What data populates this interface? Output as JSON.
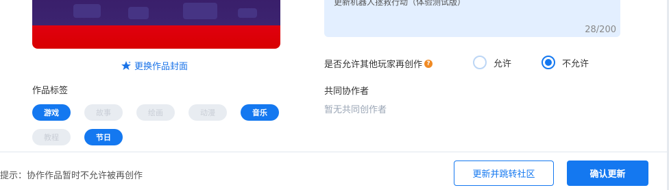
{
  "cover": {
    "change_label": "更换作品封面"
  },
  "tags": {
    "title": "作品标签",
    "items": [
      {
        "label": "游戏",
        "selected": true
      },
      {
        "label": "故事",
        "selected": false
      },
      {
        "label": "绘画",
        "selected": false
      },
      {
        "label": "动漫",
        "selected": false
      },
      {
        "label": "音乐",
        "selected": true
      },
      {
        "label": "教程",
        "selected": false
      },
      {
        "label": "节日",
        "selected": true
      }
    ]
  },
  "description": {
    "value": "更新机器人拯救行动（体验测试版）",
    "count": "28/200"
  },
  "recreate": {
    "label": "是否允许其他玩家再创作",
    "help_icon": "?",
    "options": [
      {
        "label": "允许",
        "checked": false
      },
      {
        "label": "不允许",
        "checked": true
      }
    ]
  },
  "collaborators": {
    "title": "共同协作者",
    "empty_text": "暂无共同创作者"
  },
  "footer": {
    "hint": "提示：协作作品暂时不允许被再创作",
    "jump_button": "更新并跳转社区",
    "confirm_button": "确认更新"
  },
  "colors": {
    "accent": "#1478f0",
    "tag_off_bg": "#e8ecf1",
    "desc_bg": "#e3efff"
  }
}
